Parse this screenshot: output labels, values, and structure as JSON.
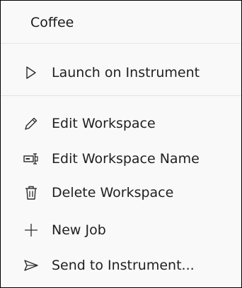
{
  "menu": {
    "title": "Coffee",
    "items": [
      {
        "label": "Launch on Instrument",
        "icon": "play-outline-icon"
      },
      {
        "label": "Edit Workspace",
        "icon": "pencil-icon"
      },
      {
        "label": "Edit Workspace Name",
        "icon": "rename-icon"
      },
      {
        "label": "Delete Workspace",
        "icon": "trash-icon"
      },
      {
        "label": "New Job",
        "icon": "plus-icon"
      },
      {
        "label": "Send to Instrument...",
        "icon": "send-icon"
      }
    ]
  },
  "colors": {
    "background": "#f9f9f9",
    "text": "#1f1f1f",
    "divider": "#e3e3e3",
    "border": "#000000"
  }
}
